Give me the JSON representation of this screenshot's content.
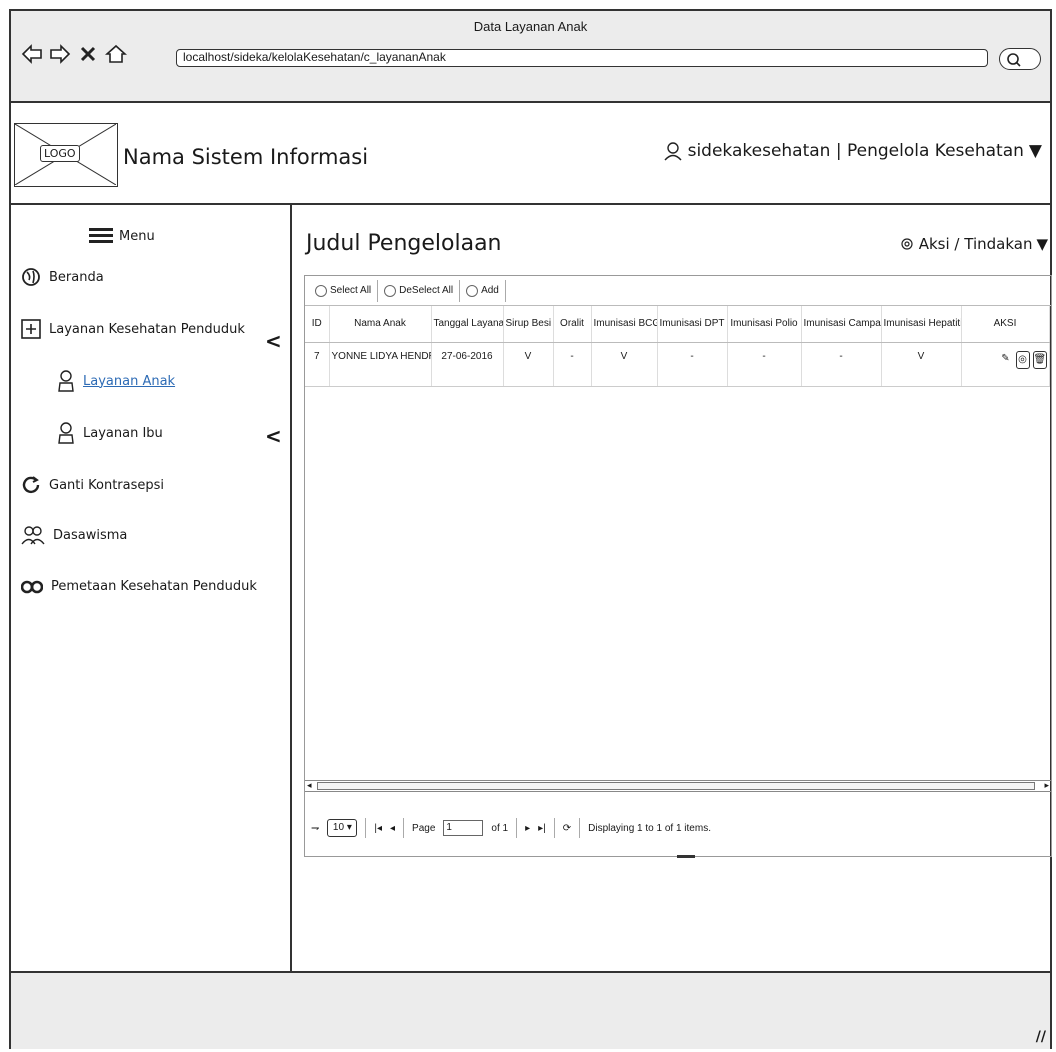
{
  "window": {
    "title": "Data Layanan Anak"
  },
  "browser": {
    "url": "localhost/sideka/kelolaKesehatan/c_layananAnak"
  },
  "header": {
    "logo_text": "LOGO",
    "app_name": "Nama Sistem Informasi",
    "user": "sidekakesehatan | Pengelola Kesehatan"
  },
  "sidebar": {
    "menu_label": "Menu",
    "items": [
      {
        "label": "Beranda"
      },
      {
        "label": "Layanan Kesehatan Penduduk"
      },
      {
        "label": "Layanan Anak",
        "active": true
      },
      {
        "label": "Layanan Ibu"
      },
      {
        "label": "Ganti Kontrasepsi"
      },
      {
        "label": "Dasawisma"
      },
      {
        "label": "Pemetaan Kesehatan Penduduk"
      }
    ]
  },
  "main": {
    "title": "Judul Pengelolaan",
    "actions_label": "Aksi / Tindakan"
  },
  "grid": {
    "toolbar": {
      "select_all": "Select All",
      "deselect_all": "DeSelect All",
      "add": "Add"
    },
    "columns": [
      "ID",
      "Nama Anak",
      "Tanggal Layanan",
      "Sirup Besi",
      "Oralit",
      "Imunisasi BCG",
      "Imunisasi DPT",
      "Imunisasi Polio",
      "Imunisasi Campak",
      "Imunisasi Hepatitis",
      "AKSI"
    ],
    "rows": [
      [
        "7",
        "YONNE LIDYA HENDR",
        "27-06-2016",
        "V",
        "-",
        "V",
        "-",
        "-",
        "-",
        "V"
      ]
    ],
    "pager": {
      "page_size": "10",
      "page_label": "Page",
      "page_value": "1",
      "of_label": "of 1",
      "display_text": "Displaying 1 to 1 of 1 items."
    }
  }
}
